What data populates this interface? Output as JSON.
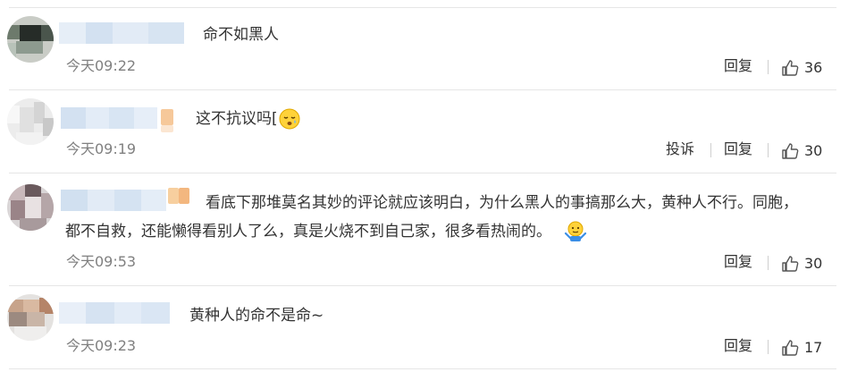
{
  "comments": [
    {
      "text": "命不如黑人",
      "time": "今天09:22",
      "reply_label": "回复",
      "likes": "36"
    },
    {
      "text": "这不抗议吗[",
      "emoji_icon": "sleepy-face-icon",
      "time": "今天09:19",
      "report_label": "投诉",
      "reply_label": "回复",
      "likes": "30"
    },
    {
      "text_line1": "看底下那堆莫名其妙的评论就应该明白，为什么黑人的事搞那么大，黄种人不行。同胞，",
      "text_line2": "都不自救，还能懒得看别人了么，真是火烧不到自己家，很多看热闹的。",
      "emoji_icon": "shrug-emoji-icon",
      "time": "今天09:53",
      "reply_label": "回复",
      "likes": "30"
    },
    {
      "text": "黄种人的命不是命~",
      "time": "今天09:23",
      "reply_label": "回复",
      "likes": "17"
    }
  ],
  "colors": {
    "divider": "#e6e6e6",
    "meta_text": "#808080",
    "body_text": "#333333",
    "blurred_name": "#d6e4f3"
  }
}
